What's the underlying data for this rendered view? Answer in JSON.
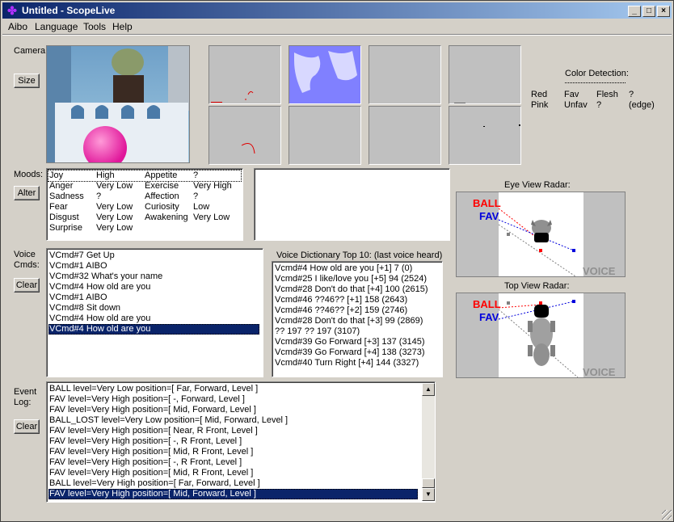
{
  "window": {
    "title": "Untitled - ScopeLive",
    "min": "_",
    "max": "□",
    "close": "×"
  },
  "menu": [
    "Aibo",
    "Language",
    "Tools",
    "Help"
  ],
  "camera": {
    "label": "Camera:",
    "size_button": "Size"
  },
  "color_detection": {
    "title": "Color Detection:",
    "rows": [
      [
        "Red",
        "Fav",
        "Flesh",
        "?"
      ],
      [
        "Pink",
        "Unfav",
        "?",
        "(edge)"
      ]
    ]
  },
  "moods": {
    "label": "Moods:",
    "alter_button": "Alter",
    "rows": [
      [
        "Joy",
        "High",
        "Appetite",
        "?"
      ],
      [
        "Anger",
        "Very Low",
        "Exercise",
        "Very High"
      ],
      [
        "Sadness",
        "?",
        "Affection",
        "?"
      ],
      [
        "Fear",
        "Very Low",
        "Curiosity",
        "Low"
      ],
      [
        "Disgust",
        "Very Low",
        "Awakening",
        "Very Low"
      ],
      [
        "Surprise",
        "Very Low",
        "",
        ""
      ]
    ]
  },
  "voice": {
    "label_line1": "Voice",
    "label_line2": "Cmds:",
    "clear_button": "Clear",
    "cmds": [
      "VCmd#7 Get Up",
      "VCmd#1 AIBO",
      "VCmd#32 What's your name",
      "VCmd#4 How old are you",
      "VCmd#1 AIBO",
      "VCmd#8 Sit down",
      "VCmd#4 How old are you",
      "VCmd#4 How old are you"
    ],
    "selected_index": 7
  },
  "dictionary": {
    "title": "Voice Dictionary Top 10: (last voice heard)",
    "items": [
      "Vcmd#4 How old are you [+1] 7 (0)",
      "Vcmd#25 I like/love you [+5] 94 (2524)",
      "Vcmd#28 Don't do that [+4] 100 (2615)",
      "Vcmd#46 ??46?? [+1] 158 (2643)",
      "Vcmd#46 ??46?? [+2] 159 (2746)",
      "Vcmd#28 Don't do that [+3] 99 (2869)",
      "?? 197 ?? 197 (3107)",
      "Vcmd#39 Go Forward [+3] 137 (3145)",
      "Vcmd#39 Go Forward [+4] 138 (3273)",
      "Vcmd#40 Turn Right [+4] 144 (3327)"
    ]
  },
  "radar": {
    "eye_title": "Eye View Radar:",
    "top_title": "Top View Radar:",
    "ball": "BALL",
    "fav": "FAV",
    "voice": "VOICE",
    "ball_color": "#ff0000",
    "fav_color": "#0000dd"
  },
  "event_log": {
    "label_line1": "Event",
    "label_line2": "Log:",
    "clear_button": "Clear",
    "items": [
      "BALL level=Very Low  position=[ Far, Forward, Level ]",
      "FAV level=Very High  position=[ -, Forward, Level ]",
      "FAV level=Very High  position=[ Mid, Forward, Level ]",
      "BALL_LOST level=Very Low  position=[ Mid, Forward, Level ]",
      "FAV level=Very High  position=[ Near, R Front, Level ]",
      "FAV level=Very High  position=[ -, R Front, Level ]",
      "FAV level=Very High  position=[ Mid, R Front, Level ]",
      "FAV level=Very High  position=[ -, R Front, Level ]",
      "FAV level=Very High  position=[ Mid, R Front, Level ]",
      "BALL level=Very High  position=[ Far, Forward, Level ]",
      "FAV level=Very High  position=[ Mid, Forward, Level ]"
    ],
    "selected_index": 10
  }
}
